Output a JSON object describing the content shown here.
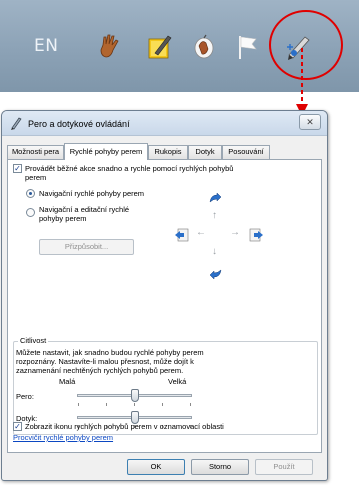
{
  "taskbar": {
    "language": "EN",
    "icons": [
      "hand-icon",
      "pen-note-icon",
      "apple-hand-icon",
      "flag-icon",
      "pen-flicks-icon"
    ]
  },
  "dialog": {
    "title": "Pero a dotykové ovládání",
    "close_label": "✕",
    "tabs": [
      {
        "label": "Možnosti pera",
        "active": false
      },
      {
        "label": "Rychlé pohyby perem",
        "active": true
      },
      {
        "label": "Rukopis",
        "active": false
      },
      {
        "label": "Dotyk",
        "active": false
      },
      {
        "label": "Posouvání",
        "active": false
      }
    ],
    "flicks_enable": {
      "checked": true,
      "label_line1": "Provádět běžné akce snadno a rychle pomocí rychlých pohybů",
      "label_line2": "perem"
    },
    "radio_nav": {
      "label": "Navigační rychlé pohyby perem",
      "selected": true
    },
    "radio_edit": {
      "label_line1": "Navigační a editační rychlé",
      "label_line2": "pohyby perem",
      "selected": false
    },
    "customize_button": "Přizpůsobit...",
    "sensitivity": {
      "group_label": "Citlivost",
      "desc_line1": "Můžete nastavit, jak snadno budou rychlé pohyby perem",
      "desc_line2": "rozpoznány. Nastavíte-li malou přesnost, může dojít k",
      "desc_line3": "zaznamenání nechtěných rychlých pohybů perem.",
      "low_label": "Malá",
      "high_label": "Velká",
      "pen_label": "Pero:",
      "touch_label": "Dotyk:",
      "pen_level": 0.5,
      "touch_level": 0.5
    },
    "show_icon": {
      "checked": true,
      "label": "Zobrazit ikonu rychlých pohybů perem v oznamovací oblasti"
    },
    "practice_link": "Procvičit rychlé pohyby perem",
    "buttons": {
      "ok": "OK",
      "cancel": "Storno",
      "apply": "Použít"
    }
  },
  "colors": {
    "annotation_red": "#e00000",
    "flick_blue": "#2a6fc9",
    "link_blue": "#0b47c2"
  }
}
